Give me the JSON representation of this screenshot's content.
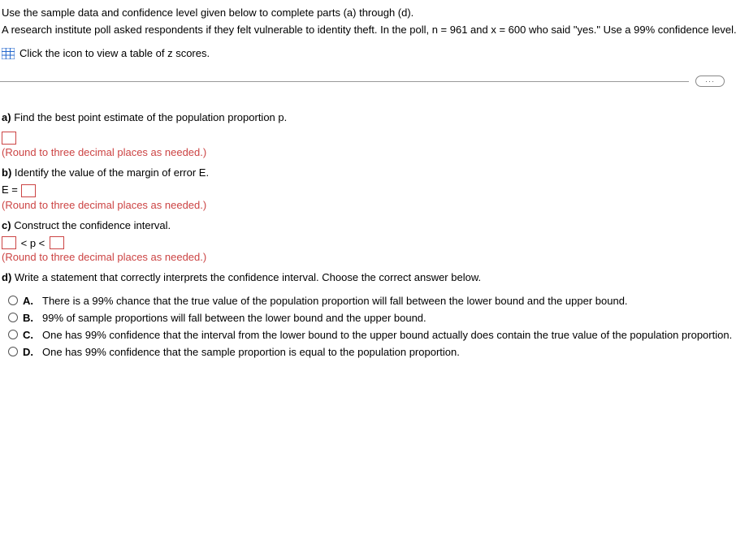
{
  "intro": {
    "line1": "Use the sample data and confidence level given below to complete parts (a) through (d).",
    "line2": "A research institute poll asked respondents if they felt vulnerable to identity theft. In the poll, n = 961 and x = 600 who said \"yes.\" Use a 99% confidence level."
  },
  "icon_link_text": "Click the icon to view a table of z scores.",
  "more_label": "···",
  "parts": {
    "a": {
      "label": "a)",
      "text": "Find the best point estimate of the population proportion p.",
      "hint": "(Round to three decimal places as needed.)"
    },
    "b": {
      "label": "b)",
      "text": "Identify the value of the margin of error E.",
      "equation_prefix": "E =",
      "hint": "(Round to three decimal places as needed.)"
    },
    "c": {
      "label": "c)",
      "text": "Construct the confidence interval.",
      "ci_middle": "< p <",
      "hint": "(Round to three decimal places as needed.)"
    },
    "d": {
      "label": "d)",
      "text": "Write a statement that correctly interprets the confidence interval. Choose the correct answer below.",
      "options": [
        {
          "label": "A.",
          "text": "There is a 99% chance that the true value of the population proportion will fall between the lower bound and the upper bound."
        },
        {
          "label": "B.",
          "text": "99% of sample proportions will fall between the lower bound and the upper bound."
        },
        {
          "label": "C.",
          "text": "One has 99% confidence that the interval from the lower bound to the upper bound actually does contain the true value of the population proportion."
        },
        {
          "label": "D.",
          "text": "One has 99% confidence that the sample proportion is equal to the population proportion."
        }
      ]
    }
  }
}
